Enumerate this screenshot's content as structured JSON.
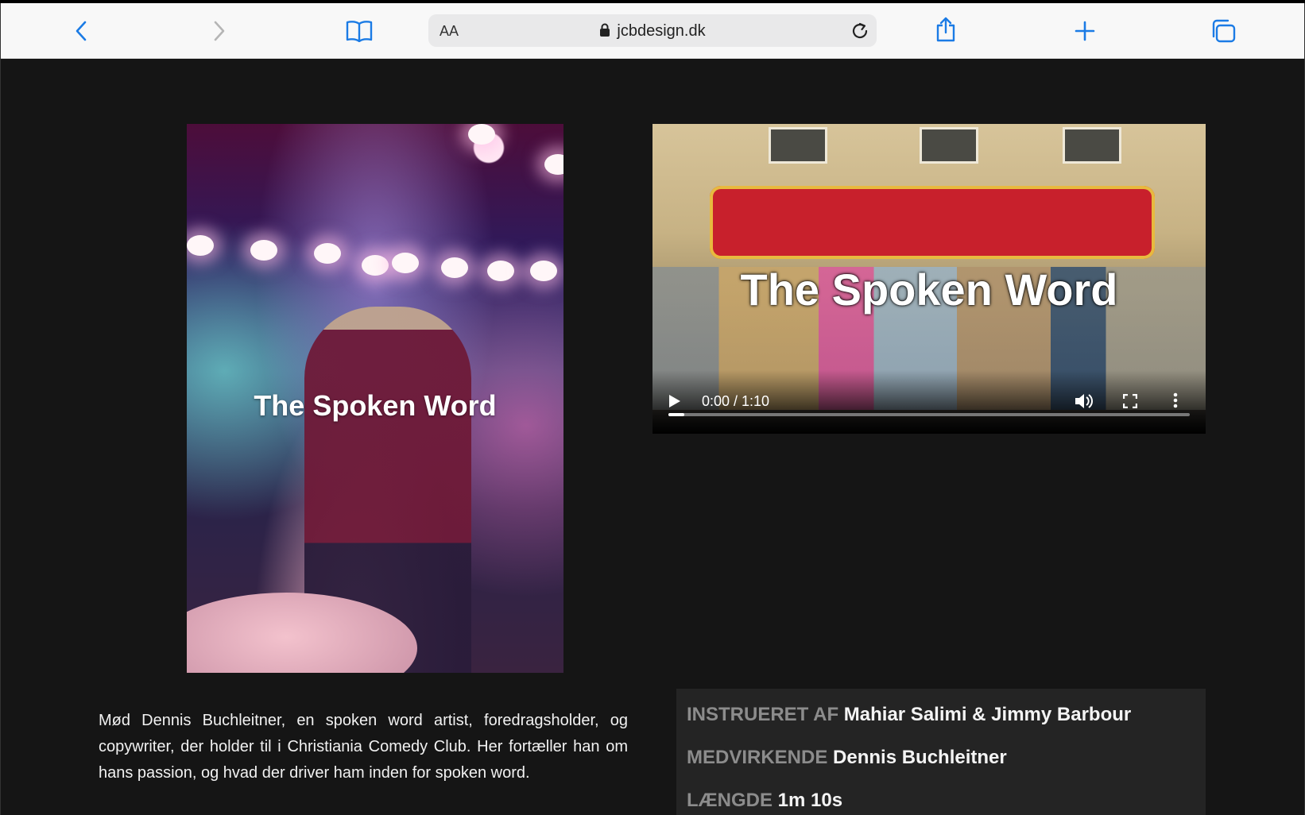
{
  "browser": {
    "address_aa": "AA",
    "url": "jcbdesign.dk",
    "accent_color": "#1b7be5"
  },
  "poster": {
    "title": "The Spoken Word"
  },
  "video": {
    "title": "The Spoken Word",
    "time": "0:00 / 1:10",
    "progress": 0.03
  },
  "description": "Mød Dennis Buchleitner, en spoken word artist, foredragsholder, og copywriter, der holder til i Christiania Comedy Club. Her fortæller han om hans passion, og hvad der driver ham inden for spoken word.",
  "credits": [
    {
      "label": "INSTRUERET AF",
      "value": "Mahiar Salimi & Jimmy Barbour"
    },
    {
      "label": "MEDVIRKENDE",
      "value": "Dennis Buchleitner"
    },
    {
      "label": "LÆNGDE",
      "value": "1m 10s"
    }
  ]
}
